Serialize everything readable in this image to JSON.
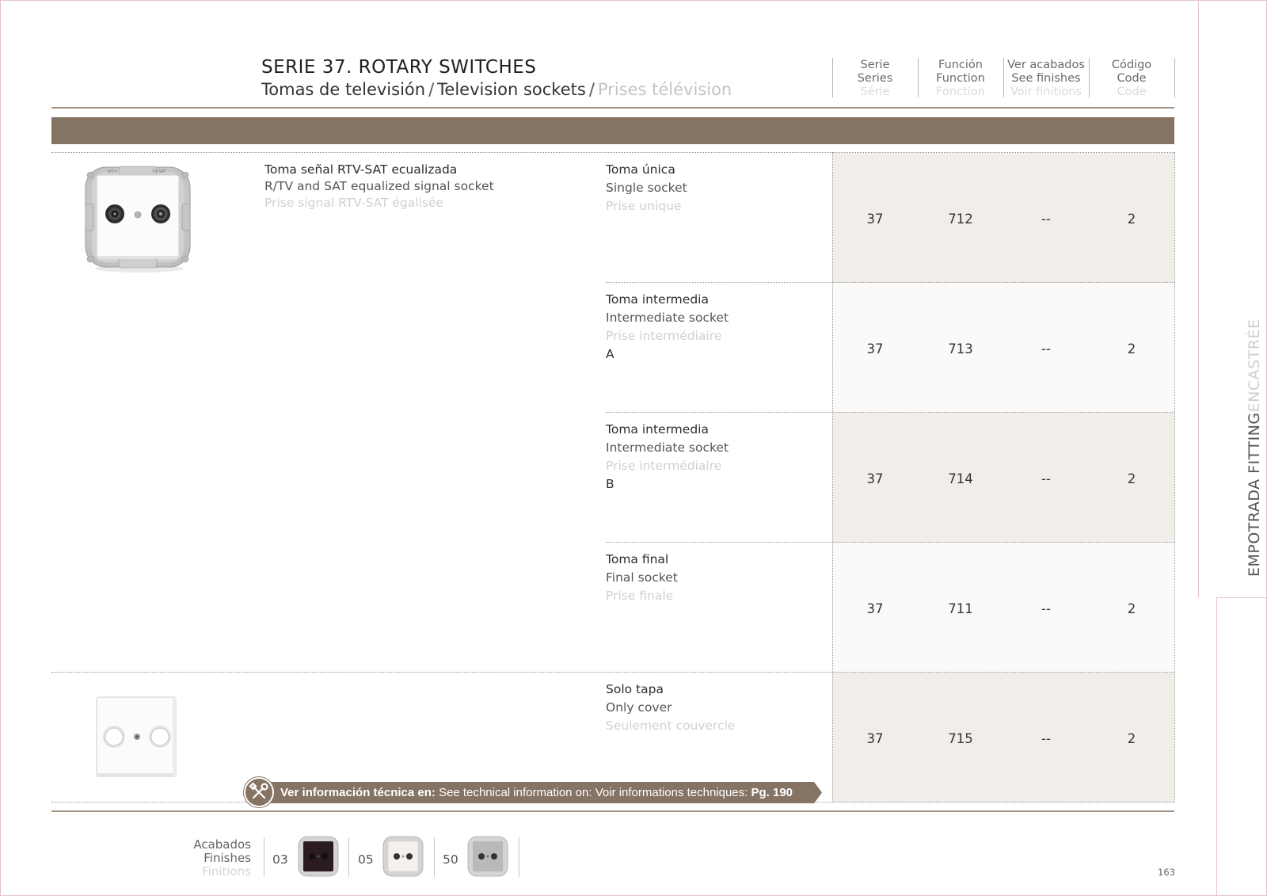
{
  "header": {
    "title": "SERIE 37. ROTARY SWITCHES",
    "subtitle_es": "Tomas de televisión",
    "subtitle_en": "Television sockets",
    "subtitle_fr": "Prises télévision",
    "separator": "/"
  },
  "columns": [
    {
      "es": "Serie",
      "en": "Series",
      "fr": "Série"
    },
    {
      "es": "Función",
      "en": "Function",
      "fr": "Fonction"
    },
    {
      "es": "Ver acabados",
      "en": "See finishes",
      "fr": "Voir finitions"
    },
    {
      "es": "Código",
      "en": "Code",
      "fr": "Code"
    }
  ],
  "product_main": {
    "es": "Toma señal RTV-SAT ecualizada",
    "en": "R/TV and SAT equalized signal socket",
    "fr": "Prise signal RTV-SAT égalisée",
    "plate_labels": [
      "R/TV",
      "TV-SAT"
    ]
  },
  "rows": [
    {
      "es": "Toma única",
      "en": "Single socket",
      "fr": "Prise unique",
      "variant": "",
      "serie": "37",
      "funcion": "712",
      "acabados": "--",
      "codigo": "2"
    },
    {
      "es": "Toma intermedia",
      "en": "Intermediate socket",
      "fr": "Prise intermédiaire",
      "variant": "A",
      "serie": "37",
      "funcion": "713",
      "acabados": "--",
      "codigo": "2"
    },
    {
      "es": "Toma intermedia",
      "en": "Intermediate socket",
      "fr": "Prise intermédiaire",
      "variant": "B",
      "serie": "37",
      "funcion": "714",
      "acabados": "--",
      "codigo": "2"
    },
    {
      "es": "Toma final",
      "en": "Final socket",
      "fr": "Prise finale",
      "variant": "",
      "serie": "37",
      "funcion": "711",
      "acabados": "--",
      "codigo": "2"
    },
    {
      "es": "Solo tapa",
      "en": "Only cover",
      "fr": "Seulement couvercle",
      "variant": "",
      "serie": "37",
      "funcion": "715",
      "acabados": "--",
      "codigo": "2"
    }
  ],
  "tech_info": {
    "es": "Ver información técnica en:",
    "en": "See technical information on:",
    "fr": "Voir informations techniques:",
    "page_ref": "Pg. 190"
  },
  "finishes": {
    "label_es": "Acabados",
    "label_en": "Finishes",
    "label_fr": "Finitions",
    "items": [
      {
        "code": "03",
        "color": "#2a1c1e"
      },
      {
        "code": "05",
        "color": "#f4f1ec"
      },
      {
        "code": "50",
        "color": "#b9b9bb"
      }
    ]
  },
  "side_tab": {
    "primary": "EMPOTRADA FITTING",
    "secondary": "ENCASTRÉE"
  },
  "page_number": "163",
  "colors": {
    "accent_brown": "#857364",
    "cell_dark": "#f1eeea",
    "cell_light": "#fbfaf9"
  }
}
